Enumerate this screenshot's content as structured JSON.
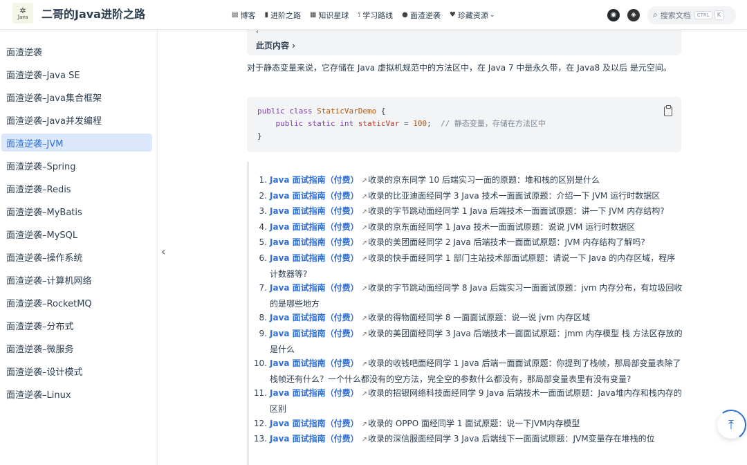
{
  "navbar": {
    "logo_mark": "✲",
    "logo_text": "Java",
    "site_title": "二哥的Java进阶之路",
    "links": [
      {
        "icon": "document-icon",
        "glyph": "▤",
        "label": "博客"
      },
      {
        "icon": "chart-icon",
        "glyph": "▮",
        "label": "进阶之路"
      },
      {
        "icon": "book-icon",
        "glyph": "▦",
        "label": "知识星球"
      },
      {
        "icon": "route-icon",
        "glyph": "⟟",
        "label": "学习路线"
      },
      {
        "icon": "circle-icon",
        "glyph": "●",
        "label": "面渣逆袭"
      },
      {
        "icon": "heart-icon",
        "glyph": "♥",
        "label": "珍藏资源",
        "caret": "⌄"
      }
    ],
    "github_glyph": "◉",
    "theme_glyph": "◈",
    "search": {
      "icon": "⌕",
      "placeholder": "搜索文档",
      "kbd_ctrl": "CTRL",
      "kbd_k": "K"
    }
  },
  "sidebar": {
    "items": [
      {
        "label": "面渣逆袭",
        "active": false
      },
      {
        "label": "面渣逆袭–Java SE",
        "active": false
      },
      {
        "label": "面渣逆袭–Java集合框架",
        "active": false
      },
      {
        "label": "面渣逆袭–Java并发编程",
        "active": false
      },
      {
        "label": "面渣逆袭–JVM",
        "active": true
      },
      {
        "label": "面渣逆袭–Spring",
        "active": false
      },
      {
        "label": "面渣逆袭–Redis",
        "active": false
      },
      {
        "label": "面渣逆袭–MyBatis",
        "active": false
      },
      {
        "label": "面渣逆袭–MySQL",
        "active": false
      },
      {
        "label": "面渣逆袭–操作系统",
        "active": false
      },
      {
        "label": "面渣逆袭–计算机网络",
        "active": false
      },
      {
        "label": "面渣逆袭–RocketMQ",
        "active": false
      },
      {
        "label": "面渣逆袭–分布式",
        "active": false
      },
      {
        "label": "面渣逆袭–微服务",
        "active": false
      },
      {
        "label": "面渣逆袭–设计模式",
        "active": false
      },
      {
        "label": "面渣逆袭–Linux",
        "active": false
      }
    ],
    "collapse_glyph": "‹"
  },
  "content": {
    "toc_fold": "‹",
    "toc_label": "此页内容 ›",
    "paragraph": "对于静态变量来说，它存储在 Java 虚拟机规范中的方法区中，在 Java 7 中是永久带，在 Java8 及以后 是元空间。",
    "code": {
      "line1": {
        "kw": "public class ",
        "cls": "StaticVarDemo",
        "rest": " {"
      },
      "line2": {
        "indent": "    ",
        "kw": "public static int ",
        "var": "staticVar",
        "eq": " = ",
        "num": "100",
        "semi": ";  ",
        "comment": "// 静态变量，存储在方法区中"
      },
      "line3": "}"
    },
    "link_text": "Java 面试指南（付费）",
    "ext_glyph": "↗",
    "questions": [
      {
        "n": "1.",
        "text": "收录的京东同学 10 后端实习一面的原题：堆和栈的区别是什么"
      },
      {
        "n": "2.",
        "text": "收录的比亚迪面经同学 3 Java 技术一面面试原题：介绍一下 JVM 运行时数据区"
      },
      {
        "n": "3.",
        "text": "收录的字节跳动面经同学 1 Java 后端技术一面面试原题：讲一下 JVM 内存结构?"
      },
      {
        "n": "4.",
        "text": "收录的京东面经同学 1 Java 技术一面面试原题：说说 JVM 运行时数据区"
      },
      {
        "n": "5.",
        "text": "收录的美团面经同学 2 Java 后端技术一面面试原题：JVM 内存结构了解吗?"
      },
      {
        "n": "6.",
        "text": "收录的快手面经同学 1 部门主站技术部面试原题：请说一下 Java 的内存区域，程序计数器等?"
      },
      {
        "n": "7.",
        "text": "收录的字节跳动面经同学 8 Java 后端实习一面面试原题：jvm 内存分布，有垃圾回收的是哪些地方"
      },
      {
        "n": "8.",
        "text": "收录的得物面经同学 8 一面面试原题：说一说 jvm 内存区域"
      },
      {
        "n": "9.",
        "text": "收录的美团面经同学 3 Java 后端技术一面面试原题：jmm 内存模型 栈 方法区存放的是什么"
      },
      {
        "n": "10.",
        "text": "收录的收钱吧面经同学 1 Java 后端一面面试原题：你提到了栈帧，那局部变量表除了栈帧还有什么？一个什么都没有的空方法，完全空的参数什么都没有，那局部变量表里有没有变量?"
      },
      {
        "n": "11.",
        "text": "收录的招银网络科技面经同学 9 Java 后端技术一面面试原题：Java堆内存和栈内存的区别"
      },
      {
        "n": "12.",
        "text": "收录的 OPPO 面经同学 1 面试原题：说一下JVM内存模型"
      },
      {
        "n": "13.",
        "text": "收录的深信服面经同学 3 Java 后端线下一面面试原题：JVM变量存在堆栈的位"
      }
    ]
  },
  "back_to_top_glyph": "⤒"
}
